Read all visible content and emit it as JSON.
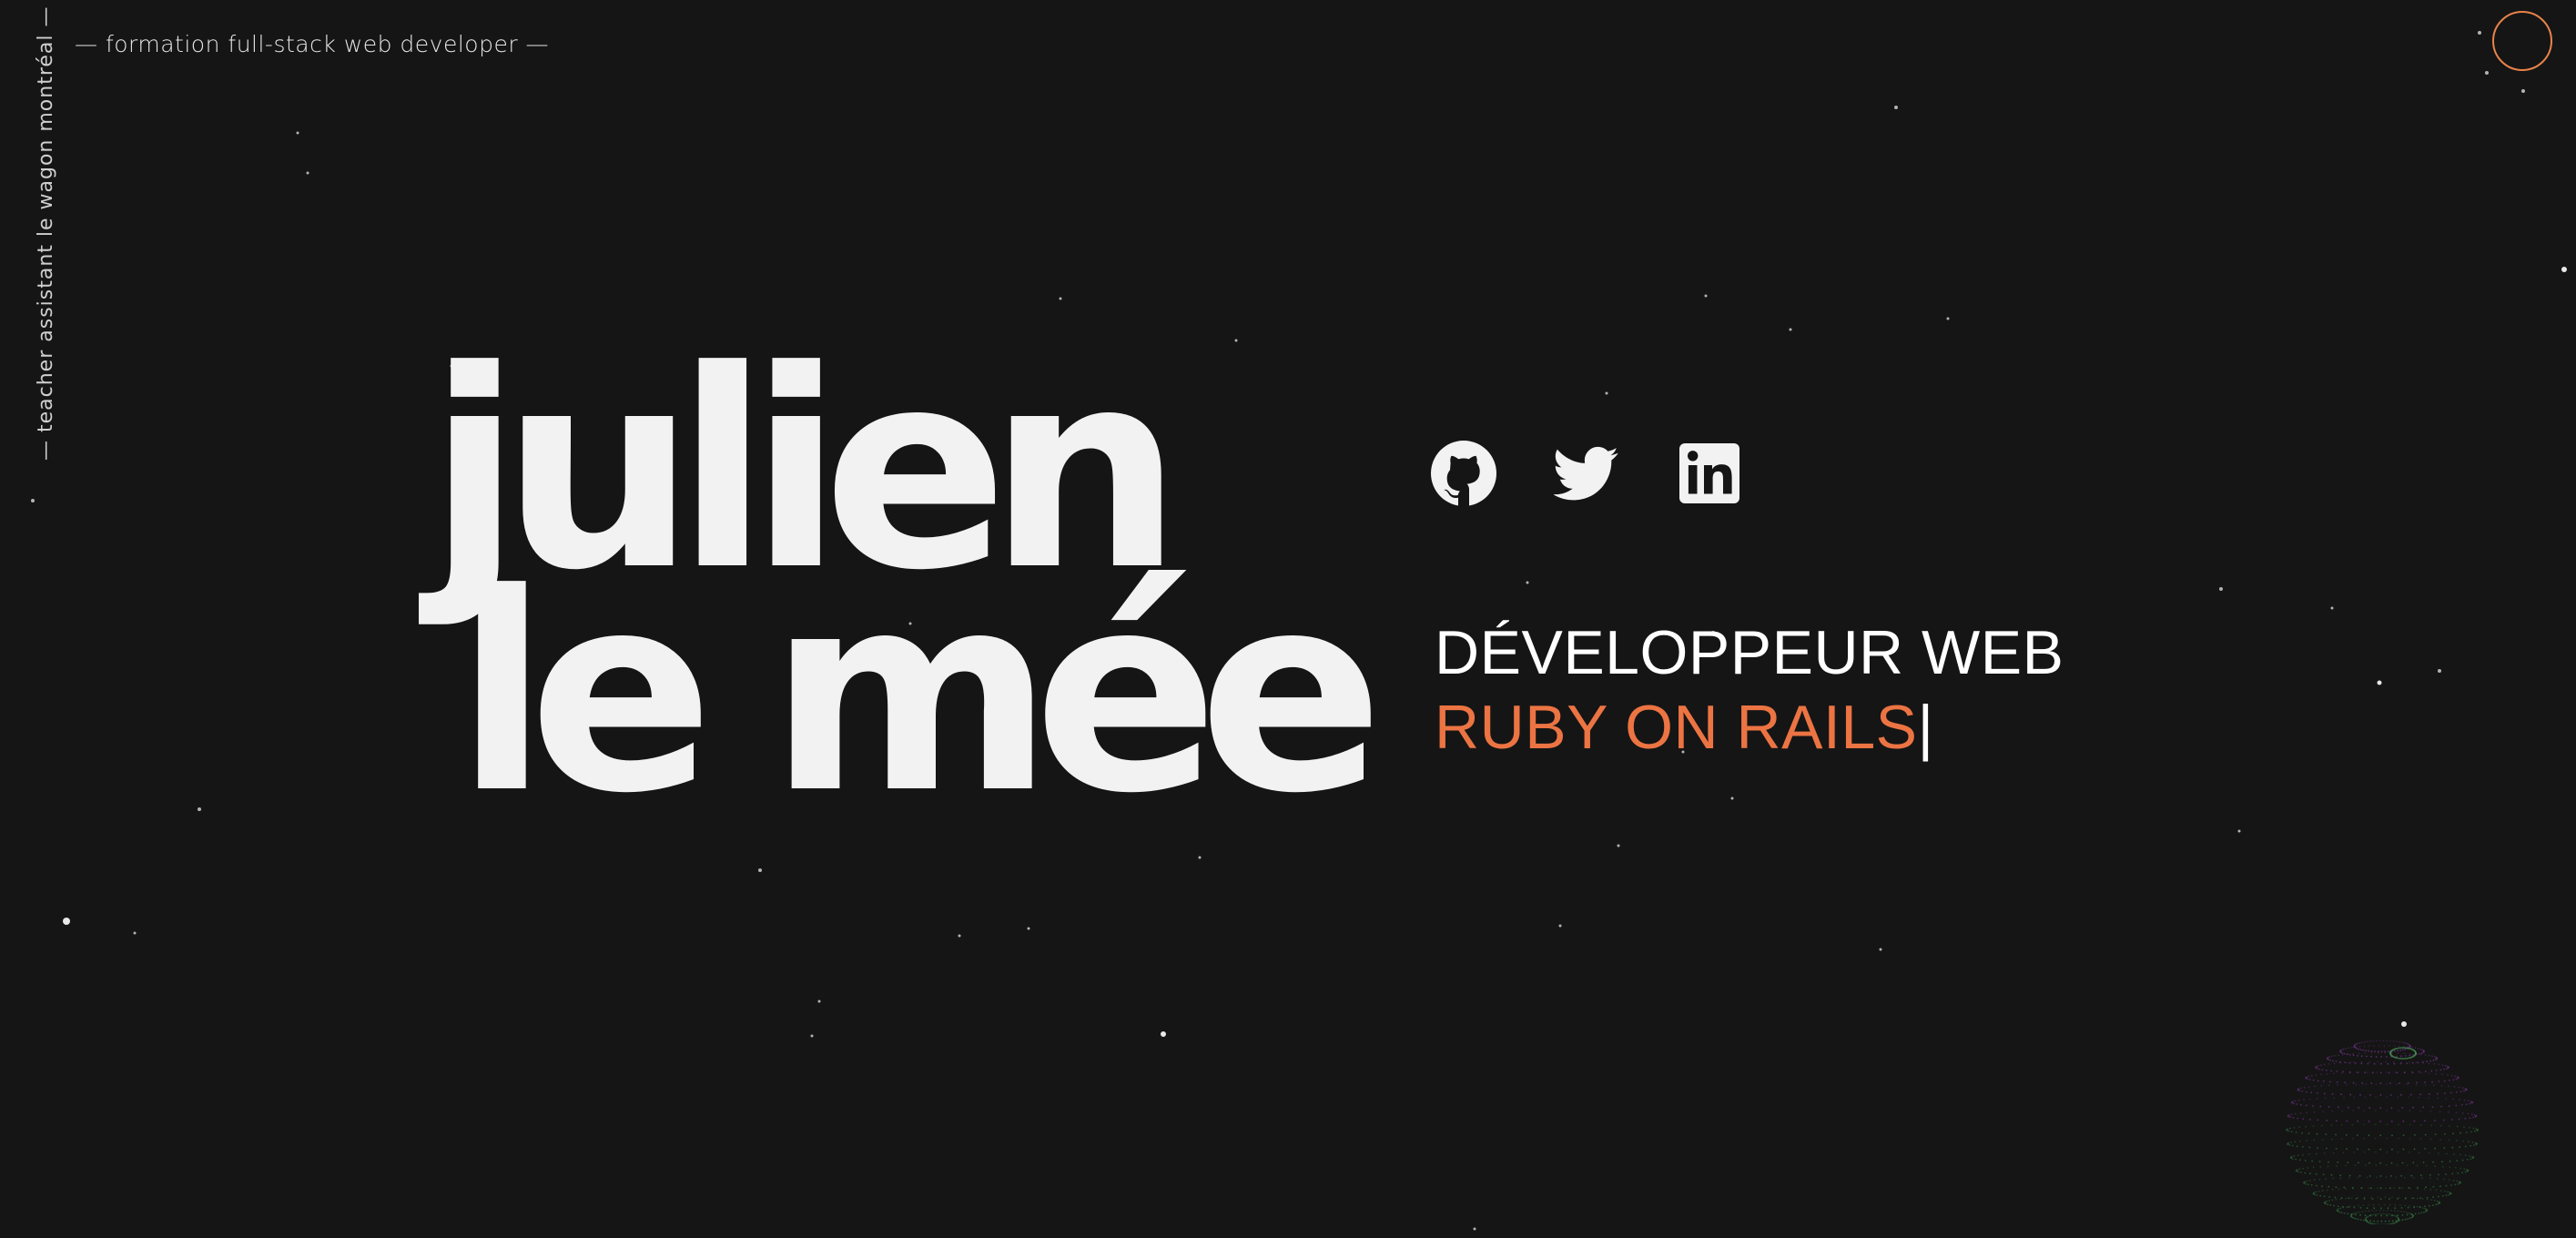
{
  "header": {
    "top_tagline": "— formation full-stack web developer —",
    "side_tagline": "— teacher assistant le wagon montréal —",
    "menu_icon": "circle-menu-icon"
  },
  "hero": {
    "name_line1": "julien",
    "name_line2": "le mée"
  },
  "socials": [
    {
      "name": "github",
      "icon": "github-icon"
    },
    {
      "name": "twitter",
      "icon": "twitter-icon"
    },
    {
      "name": "linkedin",
      "icon": "linkedin-icon"
    }
  ],
  "role": {
    "line1": "DÉVELOPPEUR WEB",
    "line2": "RUBY ON RAILS",
    "cursor": "|"
  },
  "colors": {
    "background": "#151515",
    "accent": "#ec7443",
    "menu_ring": "#e8834a",
    "text": "#f2f2f2",
    "globe_green": "#3a8a4a",
    "globe_purple": "#8a3aa8"
  }
}
